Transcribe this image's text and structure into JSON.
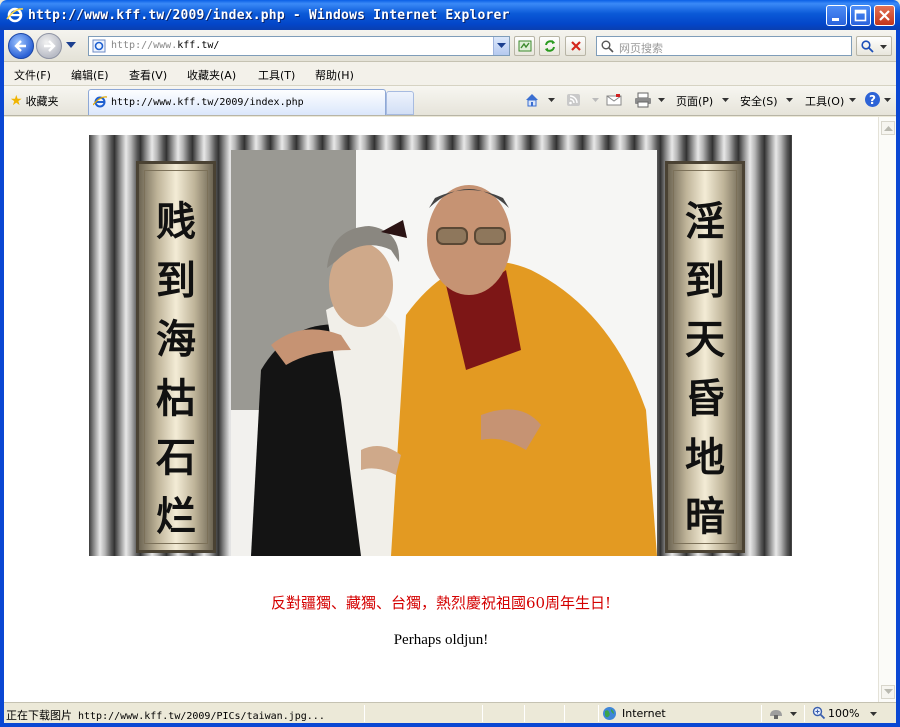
{
  "window": {
    "title": "http://www.kff.tw/2009/index.php - Windows Internet Explorer"
  },
  "navbar": {
    "address": "http://www.kff.tw/",
    "address_prefix": "http://www.",
    "address_domain": "kff.tw/",
    "search_placeholder": "网页搜索"
  },
  "menu": {
    "items": [
      {
        "label": "文件(F)"
      },
      {
        "label": "编辑(E)"
      },
      {
        "label": "查看(V)"
      },
      {
        "label": "收藏夹(A)"
      },
      {
        "label": "工具(T)"
      },
      {
        "label": "帮助(H)"
      }
    ]
  },
  "tabbar": {
    "favorites_label": "收藏夹",
    "active_tab": "http://www.kff.tw/2009/index.php",
    "page_label": "页面(P)",
    "safety_label": "安全(S)",
    "tools_label": "工具(O)"
  },
  "content": {
    "left_scroll": [
      "贱",
      "到",
      "海",
      "枯",
      "石",
      "烂"
    ],
    "right_scroll": [
      "淫",
      "到",
      "天",
      "昏",
      "地",
      "暗"
    ],
    "slogan": "反對疆獨、藏獨、台獨，熱烈慶祝祖國60周年生日!",
    "subtitle": "Perhaps oldjun!"
  },
  "status": {
    "text": "正在下载图片",
    "url": "http://www.kff.tw/2009/PICs/taiwan.jpg...",
    "zone": "Internet",
    "zoom": "100%"
  },
  "colors": {
    "titlebar": "#0a5fe6",
    "slogan": "#d40000"
  }
}
